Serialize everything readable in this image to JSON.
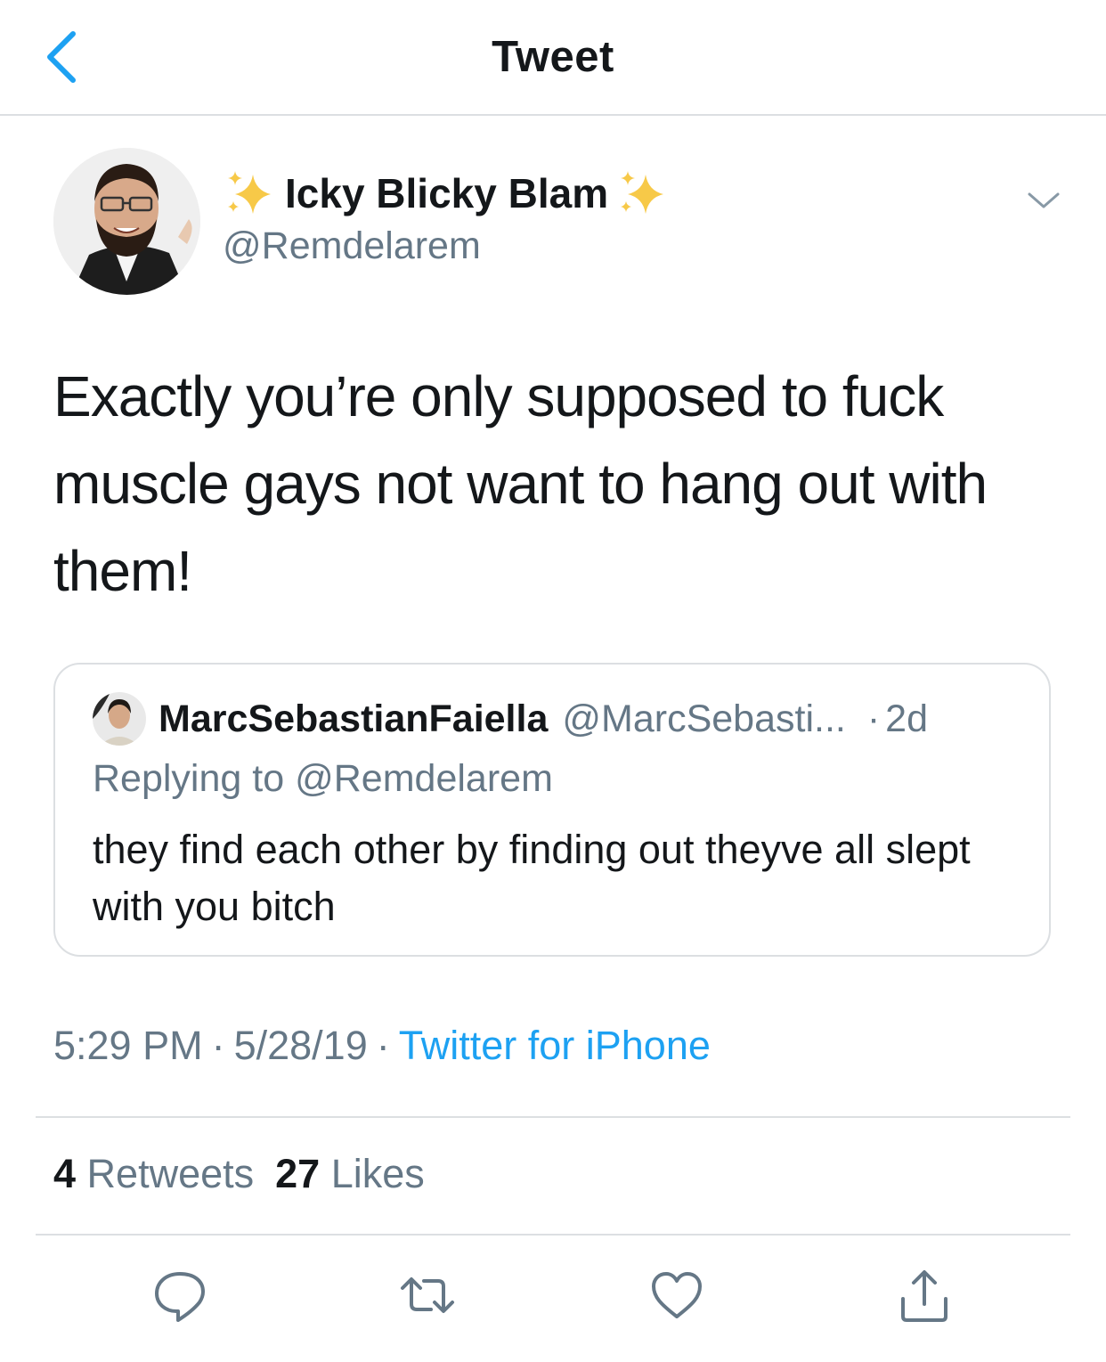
{
  "nav": {
    "title": "Tweet"
  },
  "tweet": {
    "display_name": "Icky Blicky Blam",
    "handle": "@Remdelarem",
    "text": "Exactly you’re only supposed to fuck muscle gays not want to hang out with them!",
    "time": "5:29 PM",
    "date": "5/28/19",
    "source": "Twitter for iPhone",
    "separator": "·"
  },
  "quoted": {
    "display_name": "MarcSebastianFaiella",
    "handle": "@MarcSebasti...",
    "dot": "·",
    "age": "2d",
    "replying_prefix": "Replying to",
    "replying_handle": "@Remdelarem",
    "text": "they find each other by finding out theyve all slept with you bitch"
  },
  "stats": {
    "retweets_count": "4",
    "retweets_label": "Retweets",
    "likes_count": "27",
    "likes_label": "Likes"
  },
  "actions": {
    "reply_icon": "reply-icon",
    "retweet_icon": "retweet-icon",
    "like_icon": "heart-icon",
    "share_icon": "share-icon"
  },
  "colors": {
    "accent": "#1da1f2",
    "secondary_text": "#657786",
    "primary_text": "#14171a",
    "divider": "#dcdfe2"
  }
}
